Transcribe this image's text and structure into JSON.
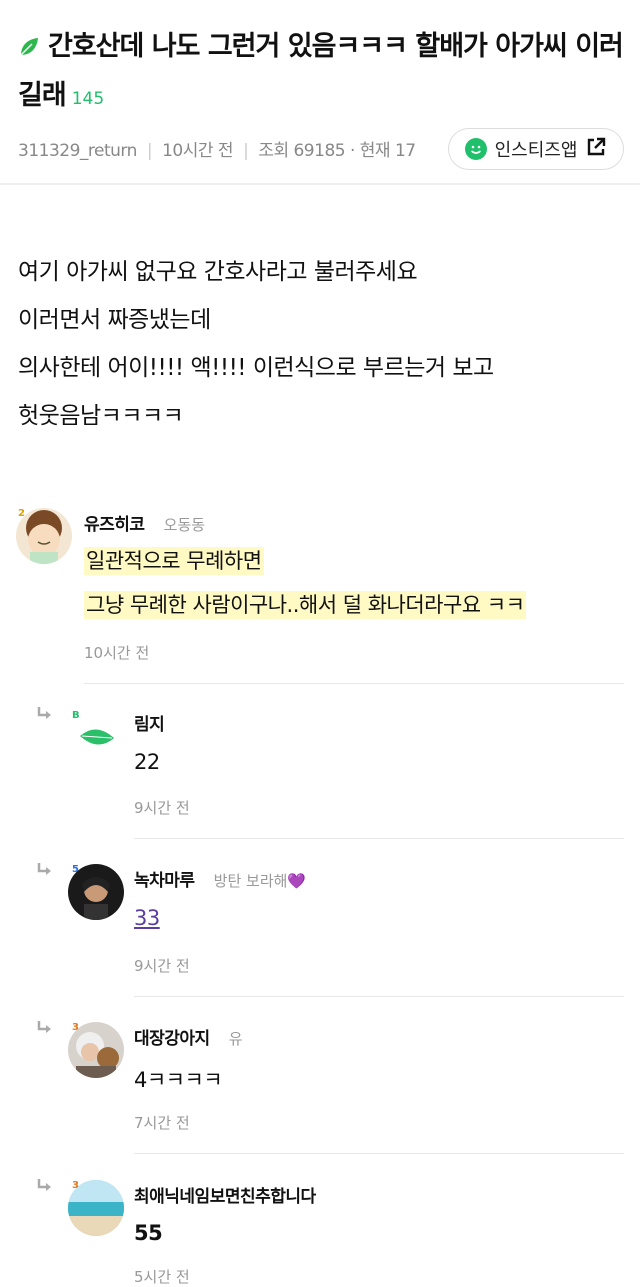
{
  "post": {
    "title": "간호산데 나도 그런거 있음ㅋㅋㅋ 할배가 아가씨 이러길래",
    "comment_count": "145",
    "author": "311329_return",
    "time": "10시간 전",
    "views": "조회 69185 · 현재 17",
    "app_button": "인스티즈앱",
    "body_lines": [
      "여기 아가씨 없구요 간호사라고 불러주세요",
      "이러면서 짜증냈는데",
      "의사한테 어이!!!! 액!!!! 이런식으로 부르는거 보고",
      "헛웃음남ㅋㅋㅋㅋ"
    ]
  },
  "comments": [
    {
      "name": "유즈히코",
      "tag": "오동동",
      "level": "2",
      "lines": [
        "일관적으로 무례하면",
        "그냥 무례한 사람이구나..해서 덜 화나더라구요 ㅋㅋ"
      ],
      "time": "10시간 전"
    },
    {
      "name": "림지",
      "tag": "",
      "level": "B",
      "text": "22",
      "time": "9시간 전"
    },
    {
      "name": "녹차마루",
      "tag": "방탄 보라해💜",
      "level": "5",
      "text": "33",
      "time": "9시간 전"
    },
    {
      "name": "대장강아지",
      "tag": "유",
      "level": "3",
      "text": "4ㅋㅋㅋㅋ",
      "time": "7시간 전"
    },
    {
      "name": "최애닉네임보면친추합니다",
      "tag": "",
      "level": "3",
      "text": "55",
      "time": "5시간 전"
    }
  ]
}
